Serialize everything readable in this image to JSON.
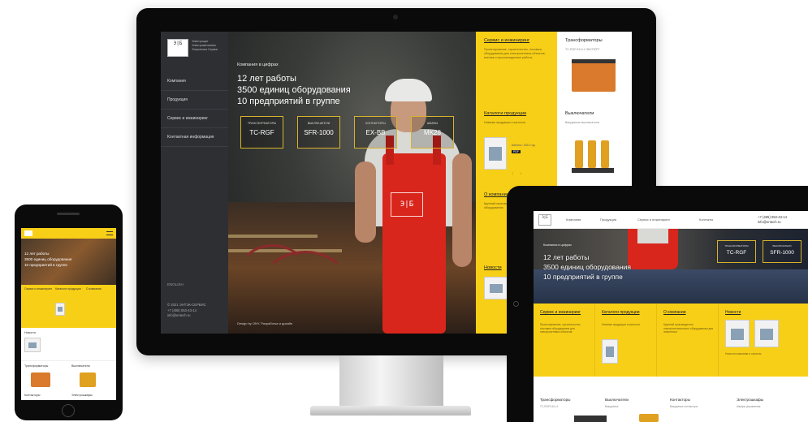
{
  "desktop": {
    "logo": {
      "mark": "Э|Б",
      "text": "Электрощит Электромеханика Энергетика Сервис"
    },
    "nav": [
      "Компания",
      "Продукция",
      "Сервис и инжиниринг",
      "Контактная информация"
    ],
    "lang": "ENGLISH",
    "footer": [
      "© 2021 ЭНТЭК-СЕРВИС",
      "+7 (495) 053-43-14",
      "info@entech.ru"
    ],
    "hero": {
      "kicker": "Компания в цифрах",
      "stats": [
        "12 лет работы",
        "3500 единиц оборудования",
        "10 предприятий в группе"
      ],
      "boxes": [
        {
          "caption": "ТРАНСФОРМАТОРЫ",
          "value": "TC-RGF"
        },
        {
          "caption": "ВЫКЛЮЧАТЕЛИ",
          "value": "SFR-1000"
        },
        {
          "caption": "КОНТАКТОРЫ",
          "value": "EX-BB"
        },
        {
          "caption": "ШКАФЫ",
          "value": "MK28"
        }
      ],
      "overall_logo": "Э|Б",
      "design_credit": "Design by ONY. Разработка и дизайн"
    },
    "cards": {
      "service": {
        "title": "Сервис и инжиниринг",
        "text": "Проектирование, строительство, поставка оборудования для электросетевых объектов, монтаж и пусконаладочные работы"
      },
      "transformers": {
        "title": "Трансформаторы",
        "text": "ТС-RGF/16-0.4 ЭКСПЕРТ"
      },
      "catalog": {
        "title": "Каталоги продукции",
        "text": "Новинки продукции и каталоги",
        "note": "Каталог: 2021 год",
        "badge": "PDF"
      },
      "switches": {
        "title": "Выключатели",
        "text": "Вакуумные выключатели"
      },
      "about": {
        "title": "О компании",
        "text": "Крупный производитель электротехнического оборудования"
      },
      "news": {
        "title": "Новости"
      }
    }
  },
  "phone": {
    "hero": [
      "12 лет работы",
      "3500 единиц оборудования",
      "10 предприятий в группе"
    ],
    "cols": [
      "Сервис и инжиниринг",
      "Каталоги продукции",
      "О компании"
    ],
    "news_label": "Новости",
    "rows": [
      "Трансформаторы",
      "Выключатели",
      "Контакторы",
      "Электрошкафы"
    ]
  },
  "tablet": {
    "logo": "Э|Б",
    "nav": [
      "Компания",
      "Продукция",
      "Сервис и инжиниринг",
      "Контакты"
    ],
    "phone": "+7 (495) 053-43-14",
    "email": "info@entech.ru",
    "hero": {
      "kicker": "Компания в цифрах",
      "stats": [
        "12 лет работы",
        "3500 единиц оборудования",
        "10 предприятий в группе"
      ],
      "boxes": [
        {
          "caption": "ТРАНСФОРМАТОРЫ",
          "value": "TC-RGF"
        },
        {
          "caption": "ВЫКЛЮЧАТЕЛИ",
          "value": "SFR-1000"
        }
      ]
    },
    "cards": [
      {
        "title": "Сервис и инжиниринг",
        "text": "Проектирование, строительство, поставка оборудования для электросетевых объектов"
      },
      {
        "title": "Каталоги продукции",
        "text": "Новинки продукции и каталоги"
      },
      {
        "title": "О компании",
        "text": "Крупный производитель электротехнического оборудования для энергетики"
      },
      {
        "title": "Новости",
        "text": "Новости компании и отрасли"
      }
    ],
    "bottom": [
      {
        "title": "Трансформаторы",
        "sub": "ТС-RGF/16-0.4"
      },
      {
        "title": "Выключатели",
        "sub": "Вакуумные"
      },
      {
        "title": "Контакторы",
        "sub": "Вакуумные контакторы"
      },
      {
        "title": "Электрошкафы",
        "sub": "Шкафы управления"
      }
    ]
  },
  "colors": {
    "accent": "#f8cf17",
    "sidebar": "#2e2f33",
    "overall": "#d8261d"
  }
}
